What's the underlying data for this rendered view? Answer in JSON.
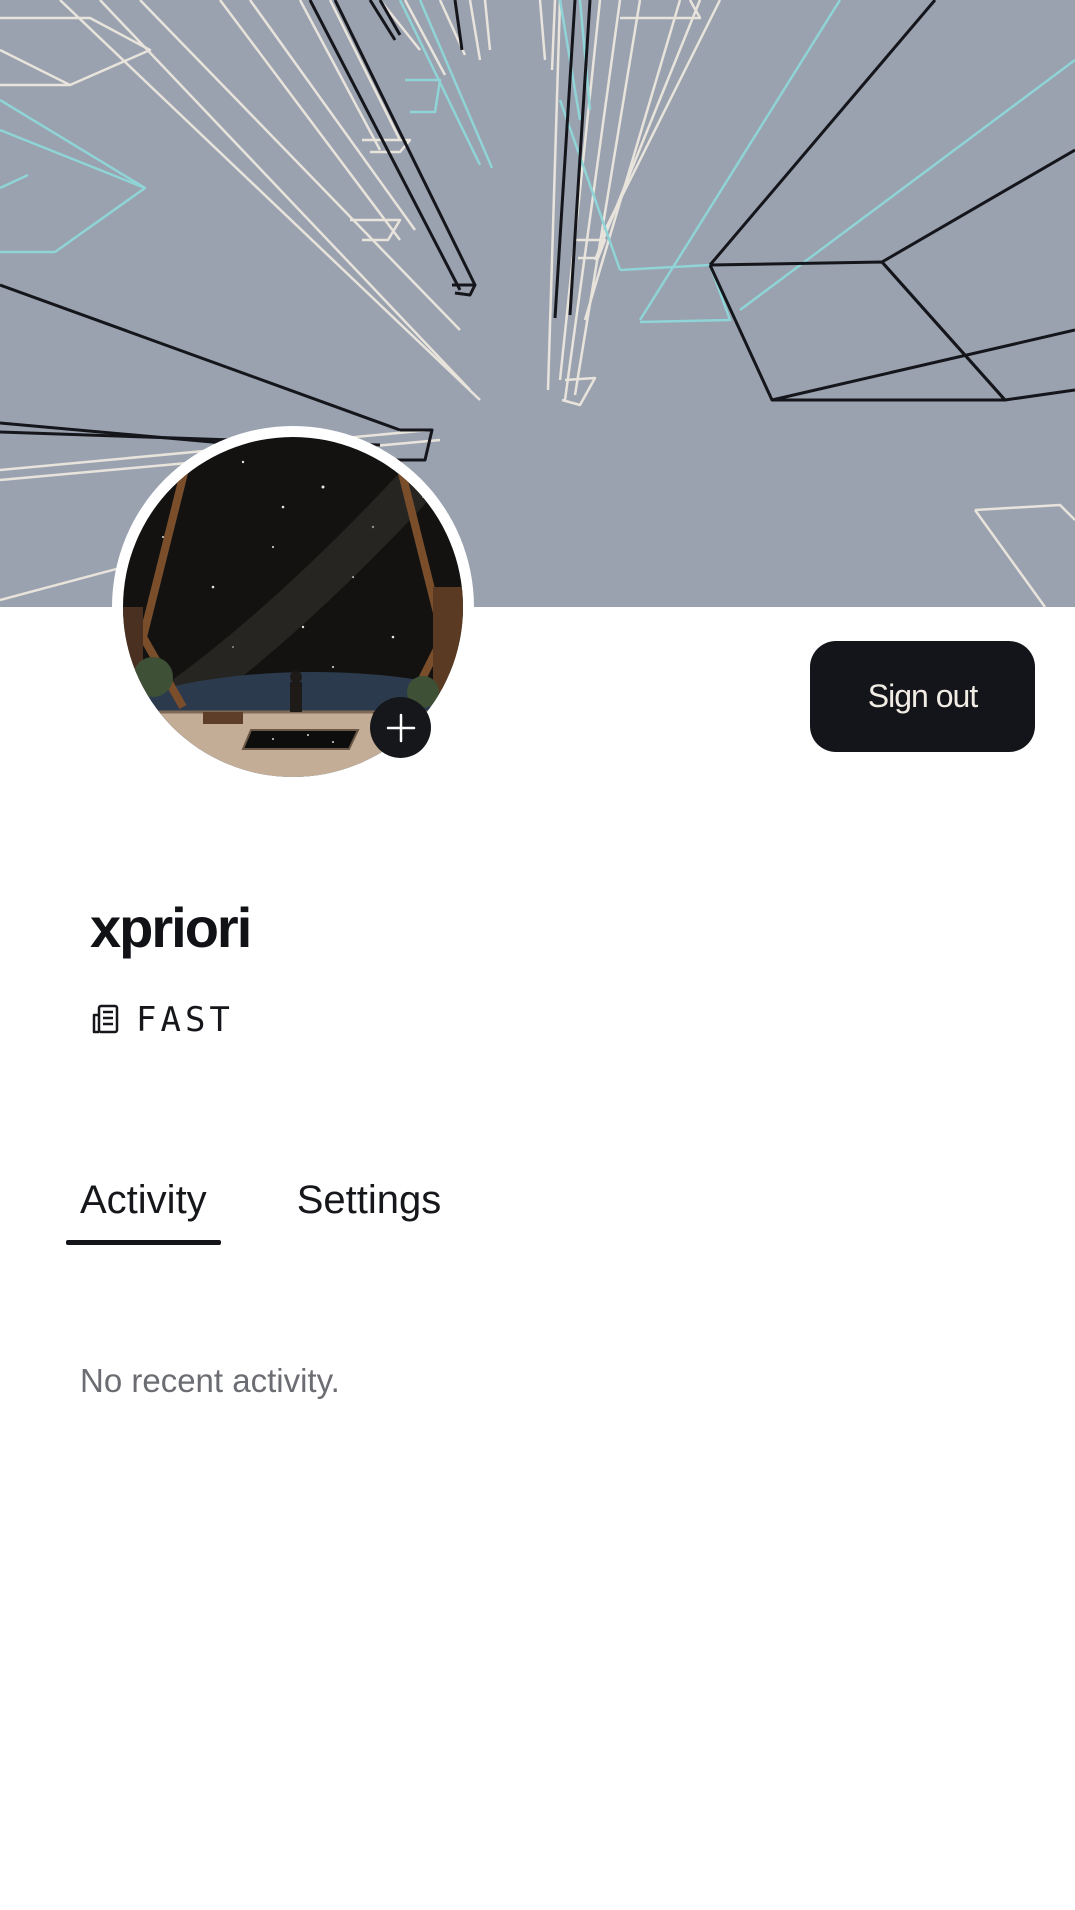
{
  "profile": {
    "username": "xpriori",
    "plan_label": "FAST",
    "plan_icon": "document-icon"
  },
  "actions": {
    "sign_out_label": "Sign out",
    "add_photo_icon": "plus-icon"
  },
  "tabs": [
    {
      "label": "Activity",
      "active": true
    },
    {
      "label": "Settings",
      "active": false
    }
  ],
  "activity": {
    "empty_message": "No recent activity."
  },
  "colors": {
    "banner_bg": "#9aa1af",
    "button_bg": "#14151a",
    "button_text": "#f1ece4",
    "muted_text": "#6b6d72"
  }
}
